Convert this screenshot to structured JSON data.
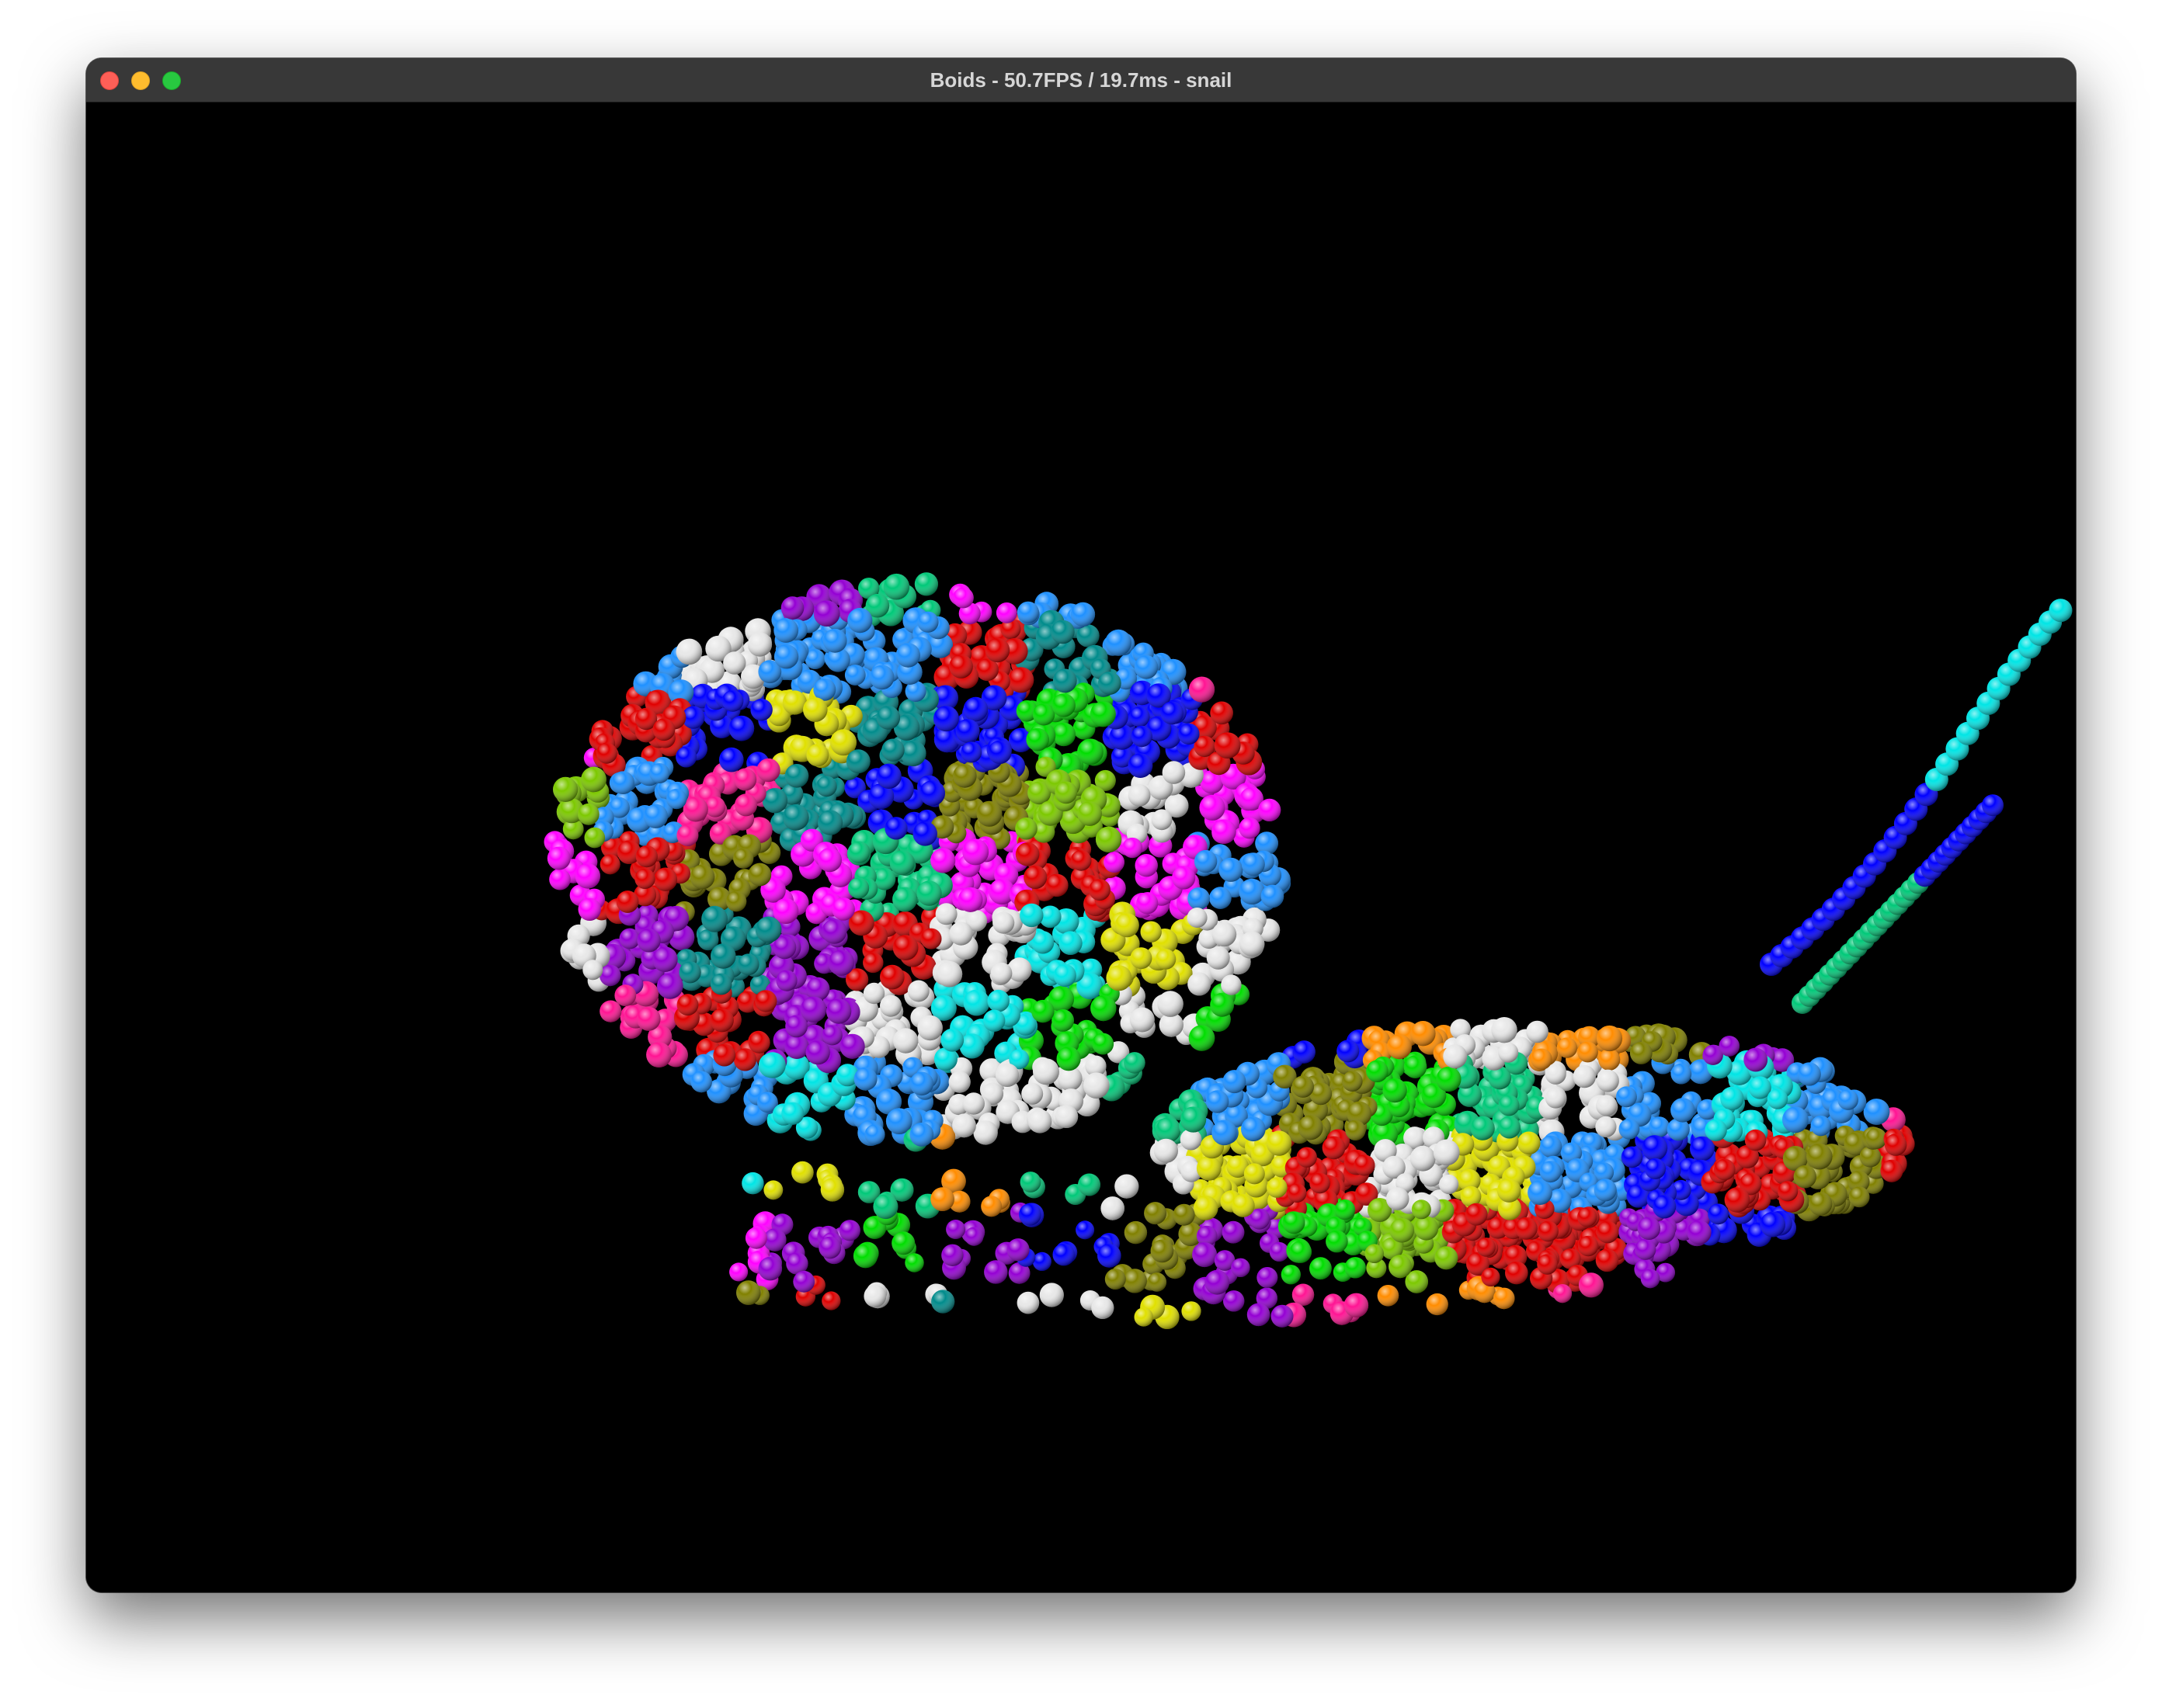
{
  "window": {
    "title": "Boids - 50.7FPS / 19.7ms - snail",
    "controls": [
      "close",
      "minimize",
      "maximize"
    ]
  },
  "scene": {
    "background": "#000000",
    "palette": [
      "#00e5e5",
      "#00dd00",
      "#ff1493",
      "#ff8c00",
      "#808000",
      "#9400d3",
      "#008b8b",
      "#e8e8e8",
      "#e0e000",
      "#ff00ff",
      "#e00000",
      "#0000ff",
      "#1e90ff",
      "#00c878",
      "#7cc800"
    ]
  }
}
